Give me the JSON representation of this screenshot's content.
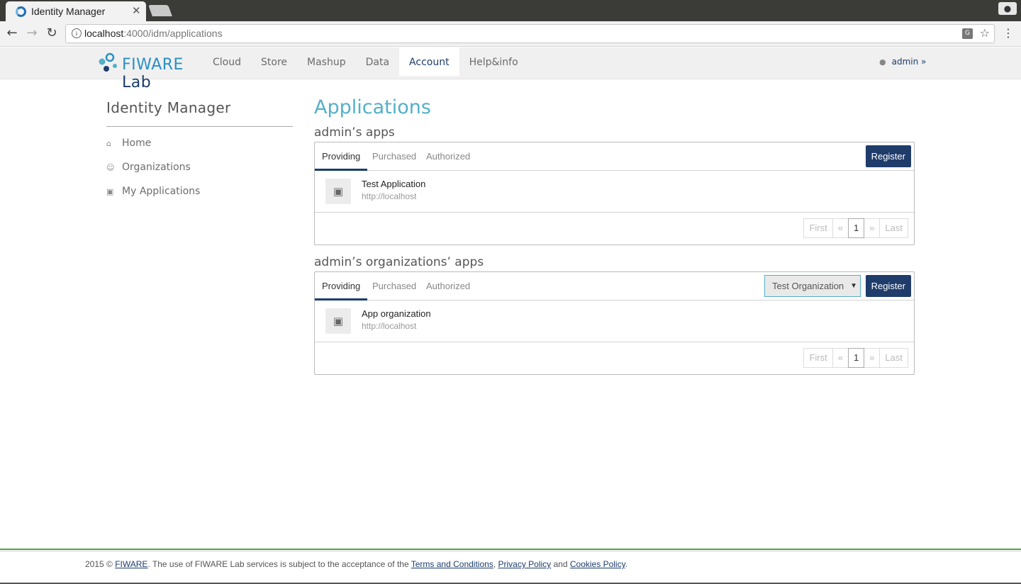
{
  "browser": {
    "tab_title": "Identity Manager",
    "tab_close": "✕",
    "url_host": "localhost",
    "url_rest": ":4000/idm/applications"
  },
  "header": {
    "logo_text": "FIWARE",
    "logo_suffix": "Lab",
    "nav": [
      "Cloud",
      "Store",
      "Mashup",
      "Data",
      "Account",
      "Help&info"
    ],
    "active_nav": "Account",
    "user": "admin"
  },
  "sidebar": {
    "title": "Identity Manager",
    "items": [
      {
        "label": "Home",
        "icon": "home-icon"
      },
      {
        "label": "Organizations",
        "icon": "users-icon"
      },
      {
        "label": "My Applications",
        "icon": "cube-icon"
      }
    ]
  },
  "main": {
    "title": "Applications",
    "sections": [
      {
        "title": "admin’s apps",
        "tabs": [
          "Providing",
          "Purchased",
          "Authorized"
        ],
        "register_label": "Register",
        "apps": [
          {
            "name": "Test Application",
            "url": "http://localhost"
          }
        ],
        "pager": {
          "first": "First",
          "prev": "«",
          "current": "1",
          "next": "»",
          "last": "Last"
        }
      },
      {
        "title": "admin’s organizations’ apps",
        "tabs": [
          "Providing",
          "Purchased",
          "Authorized"
        ],
        "select_value": "Test Organization",
        "register_label": "Register",
        "apps": [
          {
            "name": "App organization",
            "url": "http://localhost"
          }
        ],
        "pager": {
          "first": "First",
          "prev": "«",
          "current": "1",
          "next": "»",
          "last": "Last"
        }
      }
    ]
  },
  "footer": {
    "prefix": "2015 © ",
    "fiware_link": "FIWARE",
    "middle": ". The use of FIWARE Lab services is subject to the acceptance of the ",
    "terms_link": "Terms and Conditions",
    "comma": ", ",
    "privacy_link": "Privacy Policy",
    "and": " and ",
    "cookies_link": "Cookies Policy",
    "end": "."
  },
  "colors": {
    "accent": "#53b0c9",
    "brand_dark": "#1f3c6b",
    "footer_green": "#4caa38"
  }
}
